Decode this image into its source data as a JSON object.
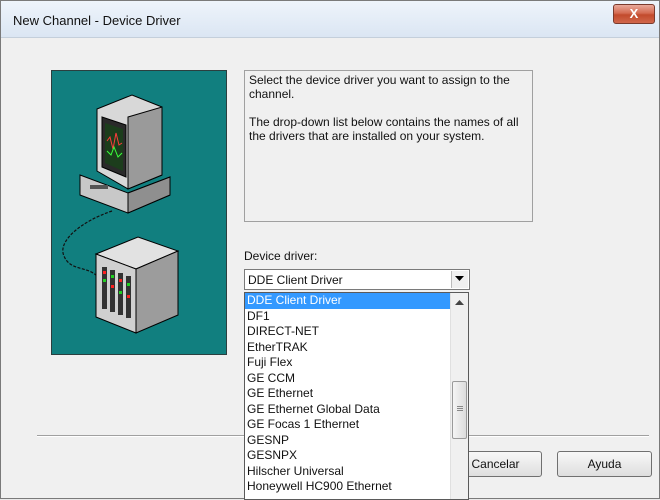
{
  "window": {
    "title": "New Channel - Device Driver",
    "close_glyph": "X"
  },
  "description": {
    "line1": "Select the device driver you want to assign to the channel.",
    "line2": "The drop-down list below contains the names of all the drivers that are installed on your system."
  },
  "device_driver": {
    "label": "Device driver:",
    "selected": "DDE Client Driver",
    "options": [
      "DDE Client Driver",
      "DF1",
      "DIRECT-NET",
      "EtherTRAK",
      "Fuji Flex",
      "GE CCM",
      "GE Ethernet",
      "GE Ethernet Global Data",
      "GE Focas 1 Ethernet",
      "GESNP",
      "GESNPX",
      "Hilscher Universal",
      "Honeywell HC900 Ethernet"
    ]
  },
  "buttons": {
    "cancel": "Cancelar",
    "help": "Ayuda"
  },
  "icons": {
    "close": "close-icon",
    "combo_arrow": "chevron-down-icon",
    "scroll_up": "scroll-up-icon"
  },
  "colors": {
    "illustration_bg": "#117f7f",
    "selection": "#3399ff",
    "close_button": "#c24b2d"
  }
}
